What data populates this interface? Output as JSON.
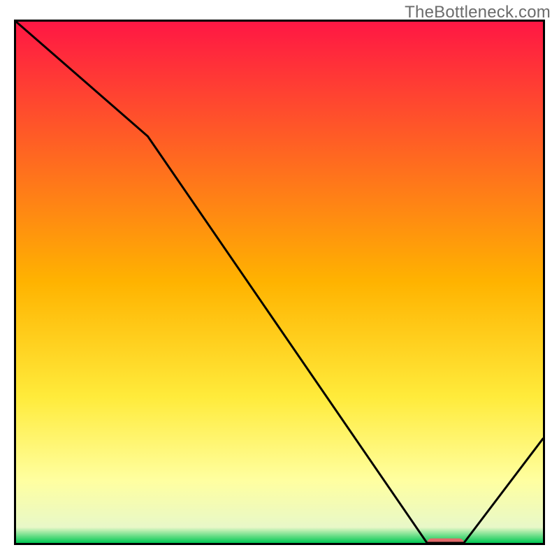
{
  "watermark": "TheBottleneck.com",
  "chart_data": {
    "type": "line",
    "title": "",
    "xlabel": "",
    "ylabel": "",
    "xlim": [
      0,
      100
    ],
    "ylim": [
      0,
      100
    ],
    "x": [
      0,
      25,
      78,
      85,
      100
    ],
    "values": [
      100,
      78,
      0,
      0,
      20
    ],
    "marker": {
      "x_start": 78,
      "x_end": 85,
      "color": "#e26a6a"
    },
    "gradient_stops": [
      {
        "offset": 0.0,
        "color": "#ff1744"
      },
      {
        "offset": 0.5,
        "color": "#ffb300"
      },
      {
        "offset": 0.72,
        "color": "#ffeb3b"
      },
      {
        "offset": 0.88,
        "color": "#ffffa0"
      },
      {
        "offset": 0.97,
        "color": "#e8f8c8"
      },
      {
        "offset": 1.0,
        "color": "#00c853"
      }
    ],
    "border_color": "#000000"
  }
}
